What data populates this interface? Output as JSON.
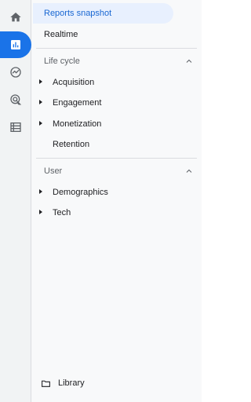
{
  "rail": {
    "items": [
      {
        "name": "home-icon",
        "active": false
      },
      {
        "name": "reports-icon",
        "active": true
      },
      {
        "name": "explore-icon",
        "active": false
      },
      {
        "name": "advertising-icon",
        "active": false
      },
      {
        "name": "configure-icon",
        "active": false
      }
    ]
  },
  "nav": {
    "reports_snapshot": "Reports snapshot",
    "realtime": "Realtime",
    "life_cycle": {
      "title": "Life cycle",
      "items": [
        "Acquisition",
        "Engagement",
        "Monetization",
        "Retention"
      ]
    },
    "user": {
      "title": "User",
      "items": [
        "Demographics",
        "Tech"
      ]
    },
    "library": "Library"
  },
  "colors": {
    "accent": "#1a73e8",
    "selected_bg": "#e8f0fe",
    "selected_text": "#1967d2"
  }
}
